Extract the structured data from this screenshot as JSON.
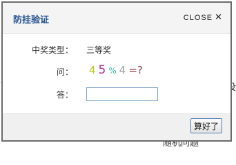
{
  "background": {
    "right_fragment": "没",
    "bottom_fragment": "随机问题"
  },
  "dialog": {
    "title": "防挂验证",
    "close_label": "CLOSE",
    "close_icon": "✕",
    "prize_type": {
      "label": "中奖类型：",
      "value": "三等奖"
    },
    "question": {
      "label": "问：",
      "captcha": [
        {
          "char": "4",
          "color": "#b8c81e",
          "size": 15
        },
        {
          "char": "5",
          "color": "#b2308f",
          "size": 17
        },
        {
          "char": "%",
          "color": "#43b6a8",
          "size": 12
        },
        {
          "char": "4",
          "color": "#9a9a9a",
          "size": 15
        },
        {
          "char": "=?",
          "color": "#8a3a3a",
          "size": 15
        }
      ]
    },
    "answer": {
      "label": "答：",
      "value": "",
      "placeholder": ""
    },
    "submit_label": "算好了"
  }
}
